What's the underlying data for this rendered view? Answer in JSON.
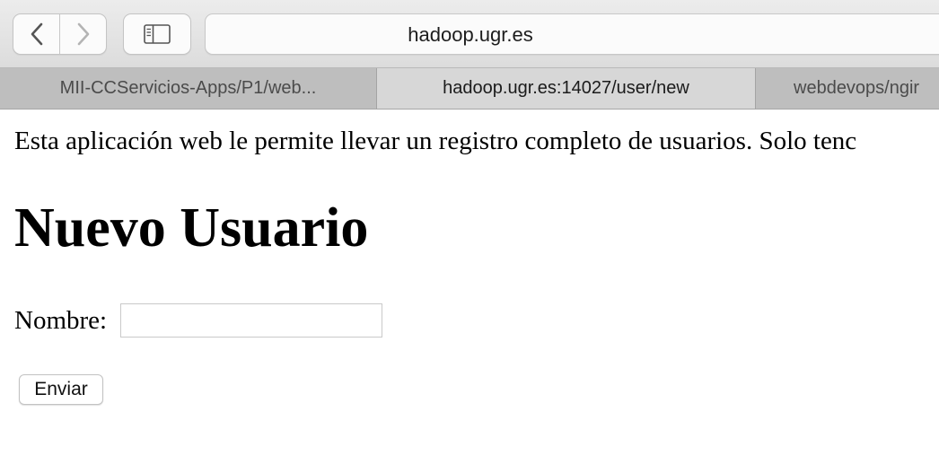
{
  "browser": {
    "address": "hadoop.ugr.es",
    "icons": {
      "back": "chevron-left-icon",
      "forward": "chevron-right-icon",
      "sidebar": "sidebar-icon"
    },
    "tabs": [
      {
        "label": "MII-CCServicios-Apps/P1/web...",
        "active": false
      },
      {
        "label": "hadoop.ugr.es:14027/user/new",
        "active": true
      },
      {
        "label": "webdevops/ngir",
        "active": false
      }
    ]
  },
  "page": {
    "intro": "Esta aplicación web le permite llevar un registro completo de usuarios. Solo tenc",
    "heading": "Nuevo Usuario",
    "form": {
      "name_label": "Nombre:",
      "name_value": "",
      "submit_label": "Enviar"
    }
  }
}
